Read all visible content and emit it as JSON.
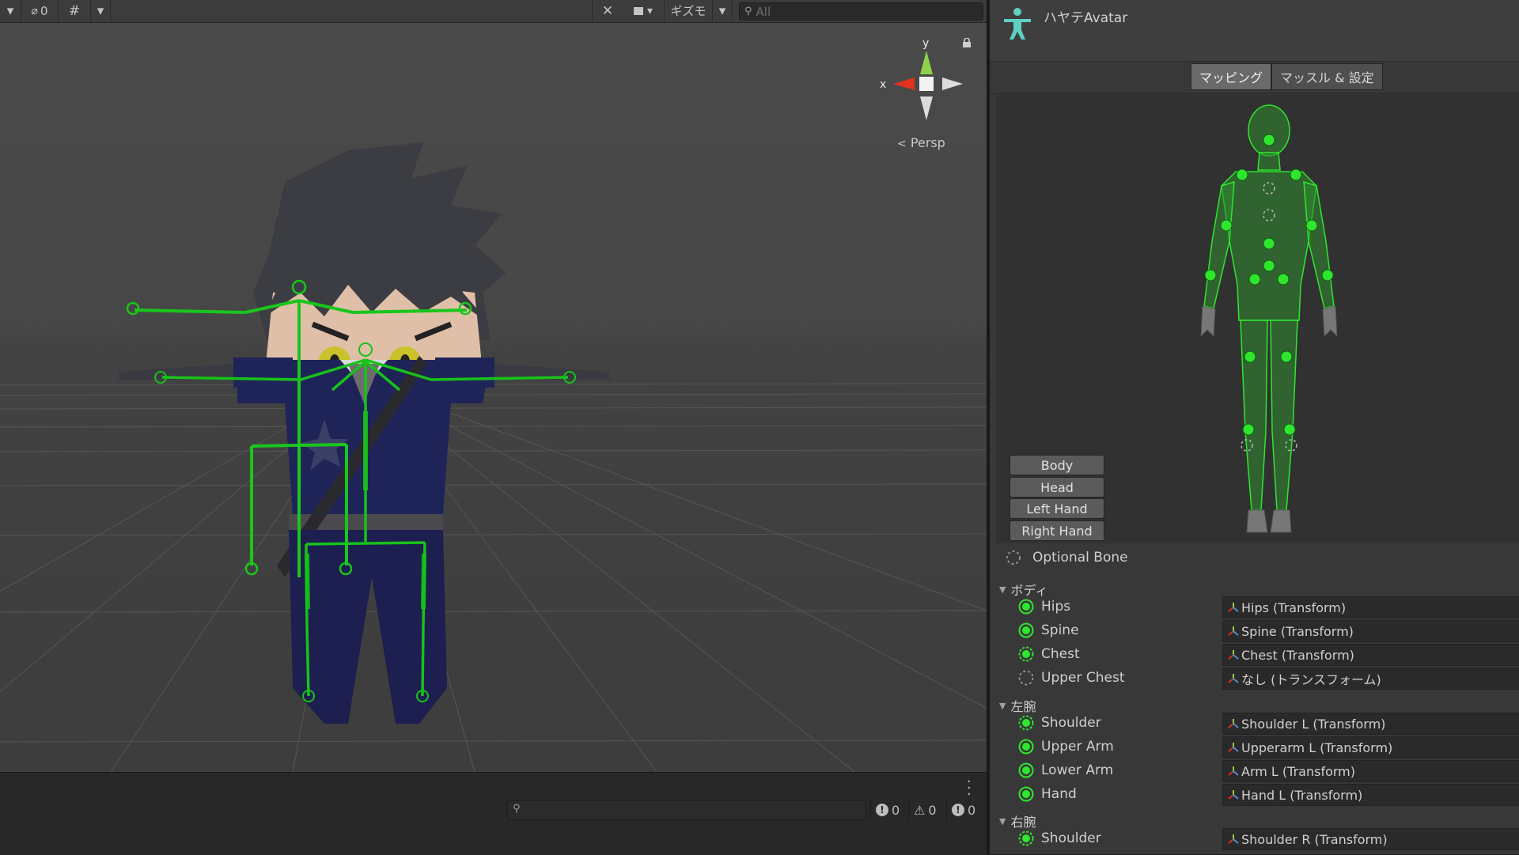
{
  "scene_toolbar": {
    "hidden_count": "0",
    "gizmos_label": "ギズモ",
    "search_placeholder": "All"
  },
  "scene_view": {
    "projection_label": "Persp",
    "gizmo_x_label": "x",
    "gizmo_y_label": "y"
  },
  "console": {
    "error_count": "0",
    "warning_count": "0",
    "message_count": "0"
  },
  "inspector": {
    "avatar_title": "ハヤテAvatar",
    "tabs": [
      {
        "label": "マッピング",
        "active": true
      },
      {
        "label": "マッスル & 設定",
        "active": false
      }
    ],
    "part_buttons": [
      "Body",
      "Head",
      "Left Hand",
      "Right Hand"
    ],
    "optional_bone_label": "Optional Bone",
    "sections": [
      {
        "title": "ボディ",
        "bones": [
          {
            "name": "Hips",
            "value": "Hips (Transform)",
            "optional": false
          },
          {
            "name": "Spine",
            "value": "Spine (Transform)",
            "optional": false
          },
          {
            "name": "Chest",
            "value": "Chest (Transform)",
            "optional": true
          },
          {
            "name": "Upper Chest",
            "value": "なし (トランスフォーム)",
            "optional": true
          }
        ]
      },
      {
        "title": "左腕",
        "bones": [
          {
            "name": "Shoulder",
            "value": "Shoulder L (Transform)",
            "optional": true
          },
          {
            "name": "Upper Arm",
            "value": "Upperarm L (Transform)",
            "optional": false
          },
          {
            "name": "Lower Arm",
            "value": "Arm L (Transform)",
            "optional": false
          },
          {
            "name": "Hand",
            "value": "Hand L (Transform)",
            "optional": false
          }
        ]
      },
      {
        "title": "右腕",
        "bones": [
          {
            "name": "Shoulder",
            "value": "Shoulder R (Transform)",
            "optional": true
          }
        ]
      }
    ]
  },
  "colors": {
    "bone_green": "#19c61c",
    "mapped_green": "#2ee62e",
    "axis_x_red": "#e0321e",
    "axis_y_green": "#8fd14a"
  }
}
